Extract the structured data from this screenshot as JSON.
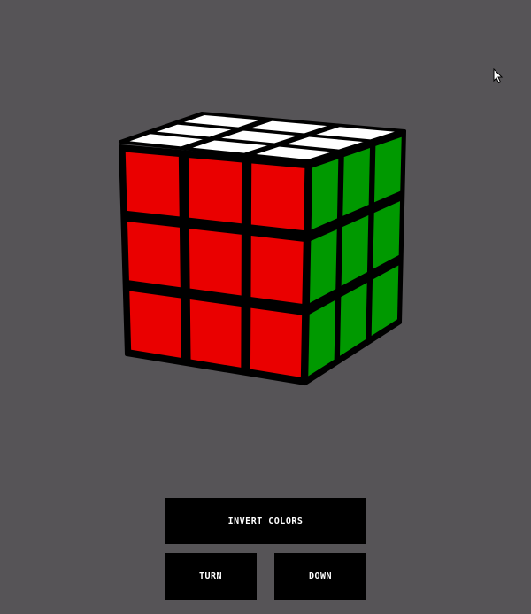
{
  "cube": {
    "face_colors": {
      "top": "#ffffff",
      "front": "#ea0000",
      "right": "#009900"
    },
    "edge_color": "#000000",
    "faces": {
      "top": [
        [
          "white",
          "white",
          "white"
        ],
        [
          "white",
          "white",
          "white"
        ],
        [
          "white",
          "white",
          "white"
        ]
      ],
      "front": [
        [
          "red",
          "red",
          "red"
        ],
        [
          "red",
          "red",
          "red"
        ],
        [
          "red",
          "red",
          "red"
        ]
      ],
      "right": [
        [
          "green",
          "green",
          "green"
        ],
        [
          "green",
          "green",
          "green"
        ],
        [
          "green",
          "green",
          "green"
        ]
      ]
    }
  },
  "controls": {
    "invert_label": "INVERT COLORS",
    "turn_label": "TURN",
    "down_label": "DOWN"
  },
  "theme": {
    "background": "#565457",
    "button_bg": "#000000",
    "button_text": "#ffffff"
  },
  "icons": {
    "cursor": "mouse-pointer-icon"
  }
}
